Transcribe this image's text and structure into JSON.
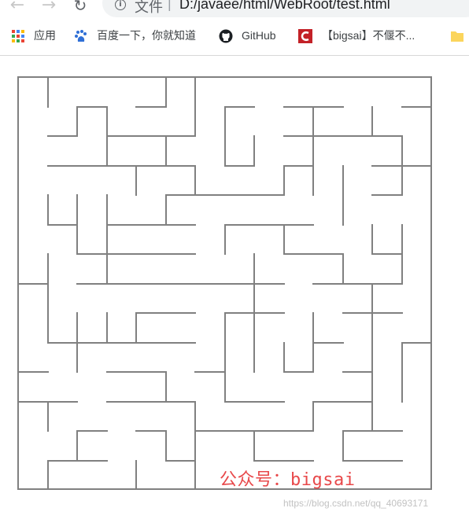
{
  "browser": {
    "url_label": "文件",
    "url_separator": "|",
    "url": "D:/javaee/html/WebRoot/test.html"
  },
  "bookmarks": [
    {
      "label": "应用",
      "icon": "apps-grid-icon"
    },
    {
      "label": "百度一下，你就知道",
      "icon": "baidu-paw-icon"
    },
    {
      "label": "GitHub",
      "icon": "github-octocat-icon"
    },
    {
      "label": "【bigsai】不偃不...",
      "icon": "csdn-logo-icon"
    },
    {
      "label": "",
      "icon": "folder-icon"
    }
  ],
  "maze": {
    "wall_color": "#808080",
    "rows": 14,
    "cols": 14,
    "walls": [
      [
        23,
        98,
        548,
        98
      ],
      [
        23,
        98,
        23,
        622
      ],
      [
        548,
        98,
        548,
        622
      ],
      [
        23,
        622,
        548,
        622
      ],
      [
        61,
        98,
        61,
        136
      ],
      [
        211,
        98,
        211,
        136
      ],
      [
        248,
        98,
        248,
        173
      ],
      [
        98,
        136,
        136,
        136
      ],
      [
        98,
        136,
        98,
        173
      ],
      [
        136,
        136,
        136,
        211
      ],
      [
        173,
        136,
        211,
        136
      ],
      [
        286,
        136,
        323,
        136
      ],
      [
        286,
        136,
        286,
        211
      ],
      [
        361,
        136,
        436,
        136
      ],
      [
        398,
        136,
        398,
        173
      ],
      [
        473,
        136,
        473,
        173
      ],
      [
        511,
        136,
        548,
        136
      ],
      [
        61,
        173,
        98,
        173
      ],
      [
        136,
        173,
        173,
        173
      ],
      [
        173,
        173,
        248,
        173
      ],
      [
        211,
        173,
        211,
        211
      ],
      [
        323,
        173,
        323,
        211
      ],
      [
        361,
        173,
        511,
        173
      ],
      [
        511,
        173,
        511,
        211
      ],
      [
        398,
        173,
        398,
        248
      ],
      [
        286,
        211,
        323,
        211
      ],
      [
        61,
        211,
        248,
        211
      ],
      [
        173,
        211,
        173,
        248
      ],
      [
        248,
        211,
        248,
        248
      ],
      [
        361,
        211,
        398,
        211
      ],
      [
        361,
        211,
        361,
        248
      ],
      [
        436,
        211,
        436,
        286
      ],
      [
        473,
        211,
        548,
        211
      ],
      [
        511,
        211,
        511,
        248
      ],
      [
        211,
        248,
        361,
        248
      ],
      [
        211,
        248,
        211,
        286
      ],
      [
        473,
        248,
        511,
        248
      ],
      [
        61,
        248,
        61,
        286
      ],
      [
        98,
        248,
        98,
        323
      ],
      [
        136,
        248,
        136,
        323
      ],
      [
        211,
        286,
        248,
        286
      ],
      [
        61,
        286,
        98,
        286
      ],
      [
        136,
        286,
        248,
        286
      ],
      [
        286,
        286,
        398,
        286
      ],
      [
        286,
        286,
        286,
        323
      ],
      [
        361,
        286,
        361,
        323
      ],
      [
        473,
        286,
        473,
        323
      ],
      [
        511,
        286,
        511,
        361
      ],
      [
        98,
        323,
        136,
        323
      ],
      [
        136,
        323,
        136,
        361
      ],
      [
        136,
        323,
        248,
        323
      ],
      [
        323,
        323,
        323,
        398
      ],
      [
        361,
        323,
        436,
        323
      ],
      [
        436,
        323,
        436,
        361
      ],
      [
        473,
        323,
        511,
        323
      ],
      [
        23,
        361,
        61,
        361
      ],
      [
        61,
        323,
        61,
        436
      ],
      [
        98,
        361,
        323,
        361
      ],
      [
        323,
        361,
        361,
        361
      ],
      [
        398,
        361,
        511,
        361
      ],
      [
        473,
        361,
        473,
        398
      ],
      [
        98,
        398,
        98,
        473
      ],
      [
        136,
        398,
        136,
        436
      ],
      [
        173,
        398,
        248,
        398
      ],
      [
        173,
        398,
        173,
        436
      ],
      [
        286,
        398,
        361,
        398
      ],
      [
        286,
        398,
        286,
        511
      ],
      [
        398,
        398,
        398,
        473
      ],
      [
        436,
        398,
        511,
        398
      ],
      [
        473,
        398,
        473,
        548
      ],
      [
        61,
        436,
        248,
        436
      ],
      [
        323,
        398,
        323,
        473
      ],
      [
        361,
        436,
        361,
        473
      ],
      [
        361,
        473,
        398,
        473
      ],
      [
        398,
        436,
        436,
        436
      ],
      [
        511,
        436,
        548,
        436
      ],
      [
        511,
        436,
        511,
        511
      ],
      [
        23,
        473,
        61,
        473
      ],
      [
        136,
        473,
        211,
        473
      ],
      [
        211,
        473,
        211,
        511
      ],
      [
        248,
        473,
        286,
        473
      ],
      [
        436,
        473,
        473,
        473
      ],
      [
        23,
        511,
        98,
        511
      ],
      [
        136,
        511,
        211,
        511
      ],
      [
        211,
        511,
        248,
        511
      ],
      [
        286,
        511,
        361,
        511
      ],
      [
        398,
        511,
        473,
        511
      ],
      [
        398,
        511,
        398,
        548
      ],
      [
        61,
        511,
        61,
        548
      ],
      [
        248,
        511,
        248,
        622
      ],
      [
        98,
        548,
        136,
        548
      ],
      [
        98,
        548,
        98,
        586
      ],
      [
        173,
        548,
        211,
        548
      ],
      [
        211,
        548,
        211,
        586
      ],
      [
        248,
        548,
        398,
        548
      ],
      [
        323,
        548,
        323,
        586
      ],
      [
        436,
        548,
        511,
        548
      ],
      [
        436,
        548,
        436,
        586
      ],
      [
        61,
        586,
        136,
        586
      ],
      [
        61,
        586,
        61,
        622
      ],
      [
        173,
        586,
        173,
        622
      ],
      [
        211,
        586,
        248,
        586
      ],
      [
        323,
        586,
        398,
        586
      ],
      [
        436,
        586,
        511,
        586
      ]
    ]
  },
  "watermark": {
    "main": "公众号：bigsai",
    "url": "https://blog.csdn.net/qq_40693171"
  }
}
